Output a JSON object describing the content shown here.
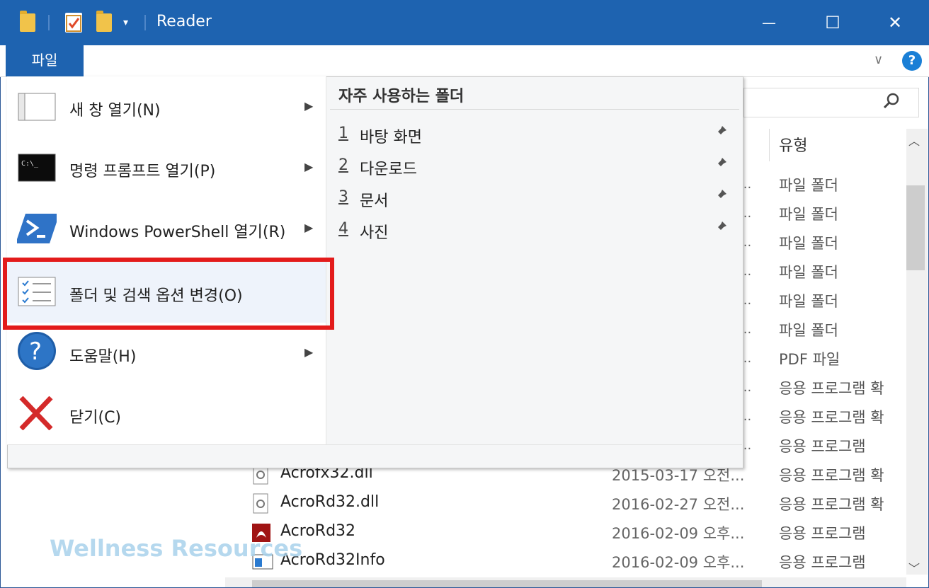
{
  "window": {
    "title": "Reader",
    "minimize": "—",
    "maximize": "☐",
    "close": "✕"
  },
  "ribbon": {
    "file_tab": "파일",
    "expand": "∨",
    "help": "?"
  },
  "list": {
    "column_type": "유형",
    "type_cells": [
      "파일 폴더",
      "파일 폴더",
      "파일 폴더",
      "파일 폴더",
      "파일 폴더",
      "파일 폴더",
      "PDF 파일",
      "응용 프로그램 확",
      "응용 프로그램 확",
      "응용 프로그램",
      "응용 프로그램 확",
      "응용 프로그램 확",
      "응용 프로그램",
      "응용 프로그램"
    ],
    "ellipsis": "...",
    "files": [
      {
        "name": "Acrofx32.dll",
        "date": "2015-03-17 오전..."
      },
      {
        "name": "AcroRd32.dll",
        "date": "2016-02-27 오전..."
      },
      {
        "name": "AcroRd32",
        "date": "2016-02-09 오후..."
      },
      {
        "name": "AcroRd32Info",
        "date": "2016-02-09 오후..."
      }
    ]
  },
  "file_menu": {
    "items": [
      {
        "label": "새 창 열기(N)",
        "icon": "window-icon",
        "has_submenu": true
      },
      {
        "label": "명령 프롬프트 열기(P)",
        "icon": "command-prompt-icon",
        "has_submenu": true
      },
      {
        "label": "Windows PowerShell 열기(R)",
        "icon": "powershell-icon",
        "has_submenu": true
      },
      {
        "label": "폴더 및 검색 옵션 변경(O)",
        "icon": "folder-options-icon",
        "has_submenu": false
      },
      {
        "label": "도움말(H)",
        "icon": "help-icon",
        "has_submenu": true
      },
      {
        "label": "닫기(C)",
        "icon": "close-x-icon",
        "has_submenu": false
      }
    ],
    "submenu_arrow": "▶",
    "recent_title": "자주 사용하는 폴더",
    "recent": [
      {
        "num": "1",
        "name": "바탕 화면"
      },
      {
        "num": "2",
        "name": "다운로드"
      },
      {
        "num": "3",
        "name": "문서"
      },
      {
        "num": "4",
        "name": "사진"
      }
    ],
    "pin": "📌"
  },
  "watermark": "Wellness Resources",
  "colors": {
    "titlebar": "#1e63b0",
    "highlight_border": "#e31b1b",
    "accent_help": "#1a7fd6"
  }
}
